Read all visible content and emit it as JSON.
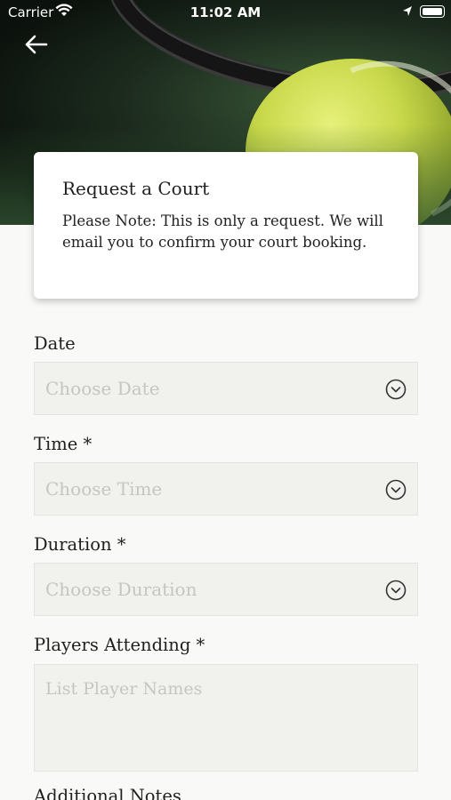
{
  "status_bar": {
    "carrier": "Carrier",
    "time": "11:02 AM"
  },
  "header": {
    "back_icon": "arrow-left-icon"
  },
  "info_card": {
    "title": "Request a Court",
    "note": "Please Note: This is only a request. We will email you to confirm your court booking."
  },
  "form": {
    "date": {
      "label": "Date",
      "placeholder": "Choose Date",
      "icon": "chevron-down-circle-icon"
    },
    "time": {
      "label": "Time *",
      "placeholder": "Choose Time",
      "icon": "chevron-down-circle-icon"
    },
    "duration": {
      "label": "Duration *",
      "placeholder": "Choose Duration",
      "icon": "chevron-down-circle-icon"
    },
    "players": {
      "label": "Players Attending *",
      "placeholder": "List Player Names"
    },
    "notes": {
      "label": "Additional Notes"
    }
  },
  "colors": {
    "field_background": "#f1f1ee",
    "placeholder_text": "#c5c5c2",
    "page_background": "#f9f9f8"
  }
}
